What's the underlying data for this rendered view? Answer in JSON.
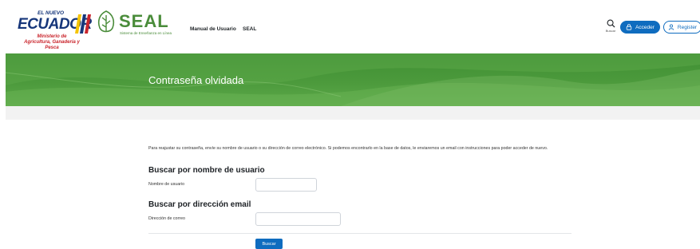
{
  "header": {
    "ecuador_logo": {
      "top_text": "EL NUEVO",
      "main_text": "ECUADOR",
      "ministry_text": "Ministerio de Agricultura, Ganadería y Pesca",
      "stripe_colors": [
        "#f5c400",
        "#16367a",
        "#c9252c"
      ]
    },
    "seal_logo": {
      "word": "SEAL",
      "subtitle": "Sistema de Enseñanza en Línea",
      "color": "#4a8c3a"
    },
    "nav": {
      "manual": "Manual de Usuario",
      "seal": "SEAL"
    },
    "search": {
      "icon": "search-icon",
      "label": "Buscar"
    },
    "acceder_label": "Acceder",
    "register_label": "Register"
  },
  "banner": {
    "title": "Contraseña olvidada",
    "color": "#4c9a3c"
  },
  "content": {
    "intro": "Para reajustar su contraseña, envíe su nombre de usuario o su dirección de correo electrónico. Si podemos encontrarlo en la base de datos, le enviaremos un email con instrucciones para poder acceder de nuevo.",
    "user_section": {
      "heading": "Buscar por nombre de usuario",
      "label": "Nombre de usuario",
      "value": ""
    },
    "email_section": {
      "heading": "Buscar por dirección email",
      "label": "Dirección de correo",
      "value": ""
    },
    "submit_label": "Buscar"
  },
  "colors": {
    "primary": "#0f6cbf",
    "banner_green": "#4c9a3c"
  }
}
